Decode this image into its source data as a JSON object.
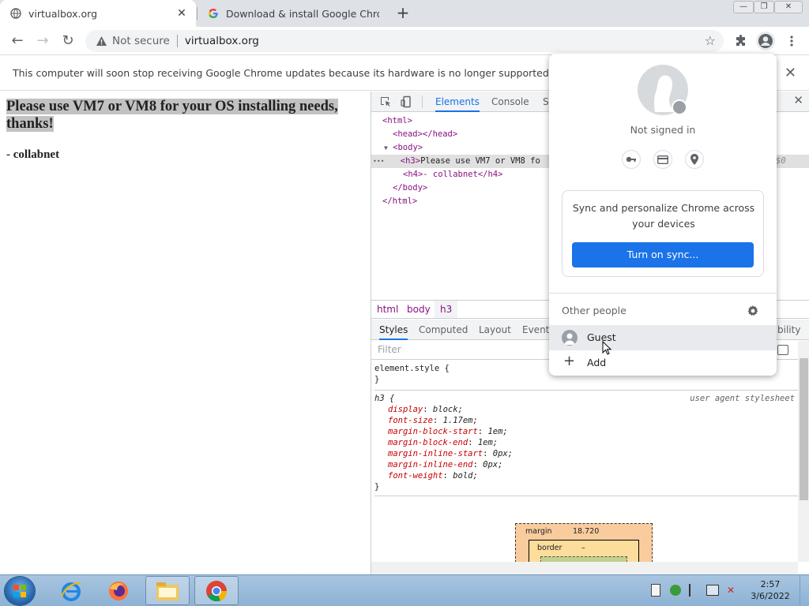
{
  "browser": {
    "tabs": [
      {
        "title": "virtualbox.org",
        "close": "✕"
      },
      {
        "title": "Download & install Google Chrome",
        "close": ""
      }
    ],
    "new_tab": "+",
    "window_controls": {
      "minimize": "—",
      "restore": "❐",
      "close": "✕"
    },
    "toolbar": {
      "back": "←",
      "forward": "→",
      "reload": "↻"
    },
    "omnibox": {
      "security_label": "Not secure",
      "url": "virtualbox.org",
      "bookmark": "☆"
    },
    "infobar": {
      "message": "This computer will soon stop receiving Google Chrome updates because its hardware is no longer supported.",
      "close": "✕"
    }
  },
  "page": {
    "heading": "Please use VM7 or VM8 for your OS installing needs, thanks!",
    "subheading": "- collabnet"
  },
  "devtools": {
    "tabs": [
      "Elements",
      "Console",
      "S"
    ],
    "close": "✕",
    "dom": {
      "html_open": "<html>",
      "head": "<head></head>",
      "body_open": "<body>",
      "h3_tag": "<h3>",
      "h3_text": "Please use VM7 or VM8 fo",
      "h3_ref": "$0",
      "h4": "<h4>- collabnet</h4>",
      "body_close": "</body>",
      "html_close": "</html>",
      "ellipsis": "•••",
      "toggle": "▼"
    },
    "breadcrumbs": [
      "html",
      "body",
      "h3"
    ],
    "sub_tabs": [
      "Styles",
      "Computed",
      "Layout",
      "Event",
      "bility"
    ],
    "filter_placeholder": "Filter",
    "styles": {
      "element_style": "element.style {",
      "close_brace": "}",
      "h3_selector": "h3 {",
      "ua_label": "user agent stylesheet",
      "props": [
        {
          "name": "display",
          "value": "block;"
        },
        {
          "name": "font-size",
          "value": "1.17em;"
        },
        {
          "name": "margin-block-start",
          "value": "1em;"
        },
        {
          "name": "margin-block-end",
          "value": "1em;"
        },
        {
          "name": "margin-inline-start",
          "value": "0px;"
        },
        {
          "name": "margin-inline-end",
          "value": "0px;"
        },
        {
          "name": "font-weight",
          "value": "bold;"
        }
      ]
    },
    "box_model": {
      "margin_label": "margin",
      "margin_value": "18.720",
      "border_label": "border",
      "border_value": "–"
    }
  },
  "profile_menu": {
    "status": "Not signed in",
    "sync_text": "Sync and personalize Chrome across your devices",
    "sync_button": "Turn on sync...",
    "other_people": "Other people",
    "guest": "Guest",
    "add": "Add"
  },
  "taskbar": {
    "time": "2:57",
    "date": "3/6/2022"
  },
  "colors": {
    "accent": "#1a73e8",
    "tag": "#881280",
    "css_property": "#c80000"
  }
}
